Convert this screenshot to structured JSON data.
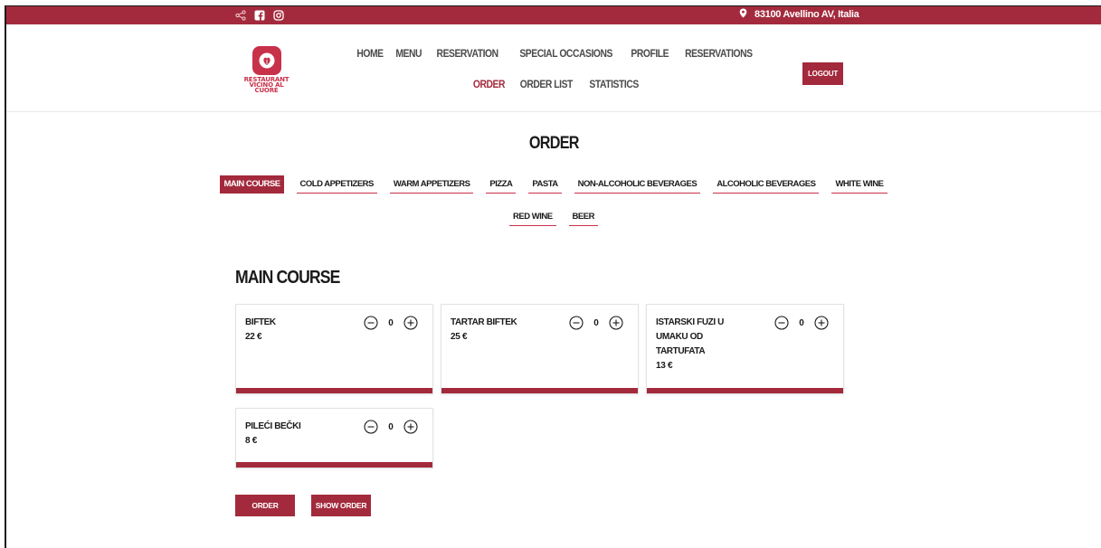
{
  "topbar": {
    "social_icons": [
      "share-icon",
      "facebook-icon",
      "instagram-icon"
    ],
    "location": "83100 Avellino AV, Italia",
    "color": "#a32a3c"
  },
  "logo": {
    "text": "RESTAURANT\nVICINO AL\nCUORE"
  },
  "nav": {
    "items": [
      "HOME",
      "MENU",
      "RESERVATION",
      "SPECIAL OCCASIONS",
      "PROFILE",
      "RESERVATIONS",
      "ORDER",
      "ORDER LIST",
      "STATISTICS"
    ],
    "active": "ORDER"
  },
  "logout_label": "LOGOUT",
  "page_title": "ORDER",
  "categories": [
    "MAIN COURSE",
    "COLD APPETIZERS",
    "WARM APPETIZERS",
    "PIZZA",
    "PASTA",
    "NON-ALCOHOLIC BEVERAGES",
    "ALCOHOLIC BEVERAGES",
    "WHITE WINE",
    "RED WINE",
    "BEER"
  ],
  "active_category": "MAIN COURSE",
  "section_title": "MAIN COURSE",
  "items": [
    {
      "name": "BIFTEK",
      "price": "22 €",
      "qty": "0"
    },
    {
      "name": "TARTAR BIFTEK",
      "price": "25 €",
      "qty": "0"
    },
    {
      "name": "ISTARSKI FUZI U UMAKU OD TARTUFATA",
      "price": "13 €",
      "qty": "0"
    },
    {
      "name": "PILEĆI BEČKI",
      "price": "8 €",
      "qty": "0"
    }
  ],
  "buttons": {
    "order": "ORDER",
    "show_order": "SHOW ORDER"
  },
  "accent_color": "#a32a3c"
}
